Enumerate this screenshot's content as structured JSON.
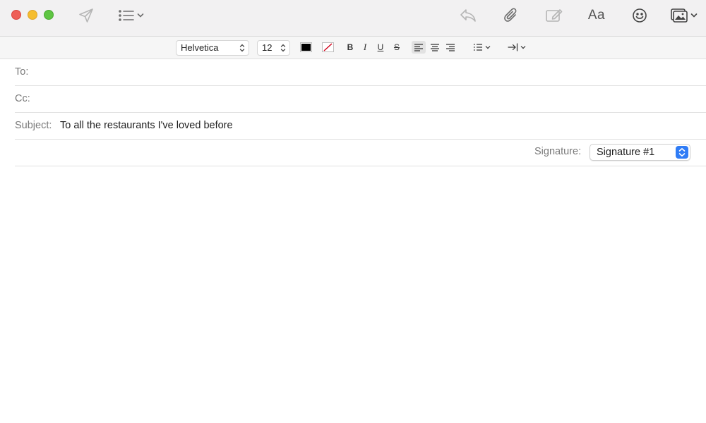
{
  "window": {
    "controls": [
      "close",
      "minimize",
      "zoom"
    ]
  },
  "toolbar": {
    "icons": [
      "send-icon",
      "header-fields-icon",
      "reply-icon",
      "attachment-icon",
      "markup-icon",
      "format-icon",
      "emoji-icon",
      "photo-browser-icon"
    ],
    "format_label": "Aa"
  },
  "formatbar": {
    "font_family": "Helvetica",
    "font_size": "12",
    "text_color": "#000000",
    "bold_label": "B",
    "italic_label": "I",
    "underline_label": "U",
    "strike_label": "S",
    "active_alignment": "left"
  },
  "header": {
    "to_label": "To:",
    "to_value": "",
    "cc_label": "Cc:",
    "cc_value": "",
    "subject_label": "Subject:",
    "subject_value": "To all the restaurants I've loved before",
    "signature_label": "Signature:",
    "signature_value": "Signature #1"
  },
  "body": {
    "text": ""
  },
  "colors": {
    "accent": "#2f7cf6",
    "close": "#ee5f57",
    "minimize": "#f5bd2f",
    "zoom": "#5fc543"
  }
}
